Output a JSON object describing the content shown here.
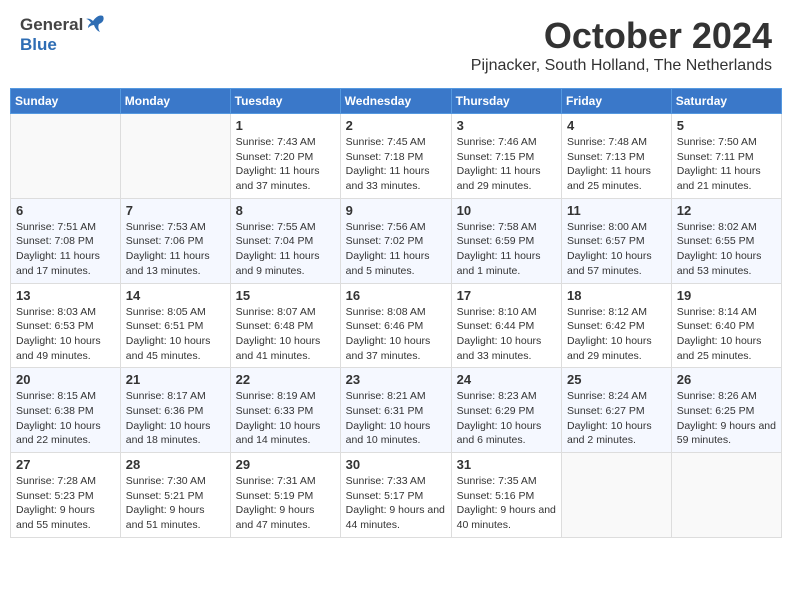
{
  "header": {
    "logo_general": "General",
    "logo_blue": "Blue",
    "month": "October 2024",
    "location": "Pijnacker, South Holland, The Netherlands"
  },
  "days_of_week": [
    "Sunday",
    "Monday",
    "Tuesday",
    "Wednesday",
    "Thursday",
    "Friday",
    "Saturday"
  ],
  "weeks": [
    [
      {
        "day": "",
        "sunrise": "",
        "sunset": "",
        "daylight": ""
      },
      {
        "day": "",
        "sunrise": "",
        "sunset": "",
        "daylight": ""
      },
      {
        "day": "1",
        "sunrise": "Sunrise: 7:43 AM",
        "sunset": "Sunset: 7:20 PM",
        "daylight": "Daylight: 11 hours and 37 minutes."
      },
      {
        "day": "2",
        "sunrise": "Sunrise: 7:45 AM",
        "sunset": "Sunset: 7:18 PM",
        "daylight": "Daylight: 11 hours and 33 minutes."
      },
      {
        "day": "3",
        "sunrise": "Sunrise: 7:46 AM",
        "sunset": "Sunset: 7:15 PM",
        "daylight": "Daylight: 11 hours and 29 minutes."
      },
      {
        "day": "4",
        "sunrise": "Sunrise: 7:48 AM",
        "sunset": "Sunset: 7:13 PM",
        "daylight": "Daylight: 11 hours and 25 minutes."
      },
      {
        "day": "5",
        "sunrise": "Sunrise: 7:50 AM",
        "sunset": "Sunset: 7:11 PM",
        "daylight": "Daylight: 11 hours and 21 minutes."
      }
    ],
    [
      {
        "day": "6",
        "sunrise": "Sunrise: 7:51 AM",
        "sunset": "Sunset: 7:08 PM",
        "daylight": "Daylight: 11 hours and 17 minutes."
      },
      {
        "day": "7",
        "sunrise": "Sunrise: 7:53 AM",
        "sunset": "Sunset: 7:06 PM",
        "daylight": "Daylight: 11 hours and 13 minutes."
      },
      {
        "day": "8",
        "sunrise": "Sunrise: 7:55 AM",
        "sunset": "Sunset: 7:04 PM",
        "daylight": "Daylight: 11 hours and 9 minutes."
      },
      {
        "day": "9",
        "sunrise": "Sunrise: 7:56 AM",
        "sunset": "Sunset: 7:02 PM",
        "daylight": "Daylight: 11 hours and 5 minutes."
      },
      {
        "day": "10",
        "sunrise": "Sunrise: 7:58 AM",
        "sunset": "Sunset: 6:59 PM",
        "daylight": "Daylight: 11 hours and 1 minute."
      },
      {
        "day": "11",
        "sunrise": "Sunrise: 8:00 AM",
        "sunset": "Sunset: 6:57 PM",
        "daylight": "Daylight: 10 hours and 57 minutes."
      },
      {
        "day": "12",
        "sunrise": "Sunrise: 8:02 AM",
        "sunset": "Sunset: 6:55 PM",
        "daylight": "Daylight: 10 hours and 53 minutes."
      }
    ],
    [
      {
        "day": "13",
        "sunrise": "Sunrise: 8:03 AM",
        "sunset": "Sunset: 6:53 PM",
        "daylight": "Daylight: 10 hours and 49 minutes."
      },
      {
        "day": "14",
        "sunrise": "Sunrise: 8:05 AM",
        "sunset": "Sunset: 6:51 PM",
        "daylight": "Daylight: 10 hours and 45 minutes."
      },
      {
        "day": "15",
        "sunrise": "Sunrise: 8:07 AM",
        "sunset": "Sunset: 6:48 PM",
        "daylight": "Daylight: 10 hours and 41 minutes."
      },
      {
        "day": "16",
        "sunrise": "Sunrise: 8:08 AM",
        "sunset": "Sunset: 6:46 PM",
        "daylight": "Daylight: 10 hours and 37 minutes."
      },
      {
        "day": "17",
        "sunrise": "Sunrise: 8:10 AM",
        "sunset": "Sunset: 6:44 PM",
        "daylight": "Daylight: 10 hours and 33 minutes."
      },
      {
        "day": "18",
        "sunrise": "Sunrise: 8:12 AM",
        "sunset": "Sunset: 6:42 PM",
        "daylight": "Daylight: 10 hours and 29 minutes."
      },
      {
        "day": "19",
        "sunrise": "Sunrise: 8:14 AM",
        "sunset": "Sunset: 6:40 PM",
        "daylight": "Daylight: 10 hours and 25 minutes."
      }
    ],
    [
      {
        "day": "20",
        "sunrise": "Sunrise: 8:15 AM",
        "sunset": "Sunset: 6:38 PM",
        "daylight": "Daylight: 10 hours and 22 minutes."
      },
      {
        "day": "21",
        "sunrise": "Sunrise: 8:17 AM",
        "sunset": "Sunset: 6:36 PM",
        "daylight": "Daylight: 10 hours and 18 minutes."
      },
      {
        "day": "22",
        "sunrise": "Sunrise: 8:19 AM",
        "sunset": "Sunset: 6:33 PM",
        "daylight": "Daylight: 10 hours and 14 minutes."
      },
      {
        "day": "23",
        "sunrise": "Sunrise: 8:21 AM",
        "sunset": "Sunset: 6:31 PM",
        "daylight": "Daylight: 10 hours and 10 minutes."
      },
      {
        "day": "24",
        "sunrise": "Sunrise: 8:23 AM",
        "sunset": "Sunset: 6:29 PM",
        "daylight": "Daylight: 10 hours and 6 minutes."
      },
      {
        "day": "25",
        "sunrise": "Sunrise: 8:24 AM",
        "sunset": "Sunset: 6:27 PM",
        "daylight": "Daylight: 10 hours and 2 minutes."
      },
      {
        "day": "26",
        "sunrise": "Sunrise: 8:26 AM",
        "sunset": "Sunset: 6:25 PM",
        "daylight": "Daylight: 9 hours and 59 minutes."
      }
    ],
    [
      {
        "day": "27",
        "sunrise": "Sunrise: 7:28 AM",
        "sunset": "Sunset: 5:23 PM",
        "daylight": "Daylight: 9 hours and 55 minutes."
      },
      {
        "day": "28",
        "sunrise": "Sunrise: 7:30 AM",
        "sunset": "Sunset: 5:21 PM",
        "daylight": "Daylight: 9 hours and 51 minutes."
      },
      {
        "day": "29",
        "sunrise": "Sunrise: 7:31 AM",
        "sunset": "Sunset: 5:19 PM",
        "daylight": "Daylight: 9 hours and 47 minutes."
      },
      {
        "day": "30",
        "sunrise": "Sunrise: 7:33 AM",
        "sunset": "Sunset: 5:17 PM",
        "daylight": "Daylight: 9 hours and 44 minutes."
      },
      {
        "day": "31",
        "sunrise": "Sunrise: 7:35 AM",
        "sunset": "Sunset: 5:16 PM",
        "daylight": "Daylight: 9 hours and 40 minutes."
      },
      {
        "day": "",
        "sunrise": "",
        "sunset": "",
        "daylight": ""
      },
      {
        "day": "",
        "sunrise": "",
        "sunset": "",
        "daylight": ""
      }
    ]
  ]
}
